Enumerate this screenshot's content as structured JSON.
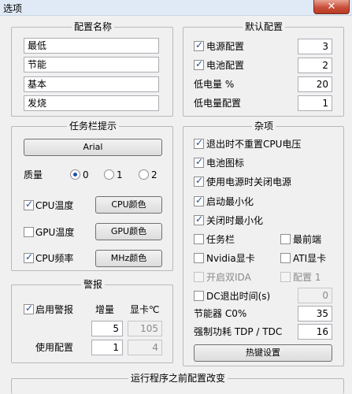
{
  "window": {
    "title": "选项",
    "close_glyph": "✕"
  },
  "profile_names": {
    "title": "配置名称",
    "items": [
      "最低",
      "节能",
      "基本",
      "发烧"
    ]
  },
  "default_profile": {
    "title": "默认配置",
    "rows": [
      {
        "label": "电源配置",
        "checked": true,
        "value": "3"
      },
      {
        "label": "电池配置",
        "checked": true,
        "value": "2"
      },
      {
        "label": "低电量 %",
        "value": "20"
      },
      {
        "label": "低电量配置",
        "value": "1"
      }
    ]
  },
  "taskbar": {
    "title": "任务栏提示",
    "font_button": "Arial",
    "quality_label": "质量",
    "quality_options": [
      "0",
      "1",
      "2"
    ],
    "quality_selected": "0",
    "rows": [
      {
        "label": "CPU温度",
        "checked": true,
        "button": "CPU颜色"
      },
      {
        "label": "GPU温度",
        "checked": false,
        "button": "GPU颜色"
      },
      {
        "label": "CPU频率",
        "checked": true,
        "button": "MHz颜色"
      }
    ]
  },
  "alarm": {
    "title": "警报",
    "enable_label": "启用警报",
    "enabled": true,
    "col_increment": "增量",
    "col_gpu": "显卡℃",
    "increment_value": "5",
    "gpu_value": "105",
    "use_profile_label": "使用配置",
    "profile_value": "1",
    "gpu_profile_value": "4"
  },
  "misc": {
    "title": "杂项",
    "items": [
      {
        "label": "退出时不重置CPU电压",
        "checked": true
      },
      {
        "label": "电池图标",
        "checked": true
      },
      {
        "label": "使用电源时关闭电源",
        "checked": true
      },
      {
        "label": "启动最小化",
        "checked": true
      },
      {
        "label": "关闭时最小化",
        "checked": true
      }
    ],
    "pairs": [
      {
        "left": "任务栏",
        "left_checked": false,
        "right": "最前端",
        "right_checked": false
      },
      {
        "left": "Nvidia显卡",
        "left_checked": false,
        "right": "ATI显卡",
        "right_checked": false
      },
      {
        "left": "开启双IDA",
        "left_disabled": true,
        "right": "配置 1",
        "right_disabled": true
      }
    ],
    "dc_exit_label": "DC退出时间(s)",
    "dc_exit_value": "0",
    "saver_label": "节能器 C0%",
    "saver_value": "35",
    "tdp_label": "强制功耗 TDP / TDC",
    "tdp_value": "16",
    "hotkey_button": "热键设置"
  },
  "bottom": {
    "title": "运行程序之前配置改变"
  }
}
